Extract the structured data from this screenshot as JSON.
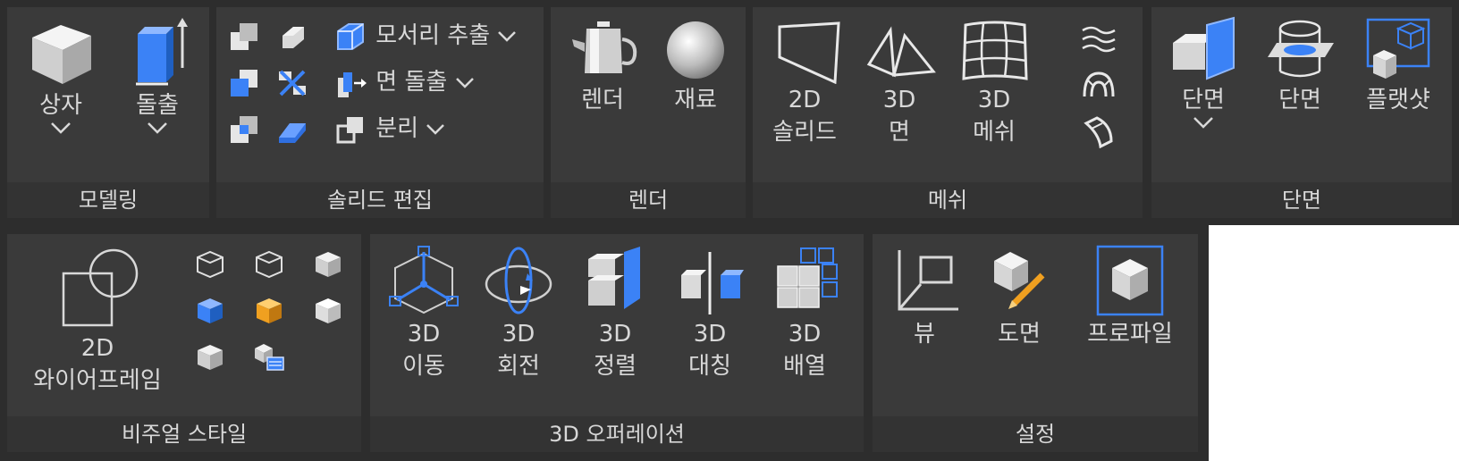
{
  "ribbon": {
    "modeling": {
      "title": "모델링",
      "box_label": "상자",
      "extrude_label": "돌출"
    },
    "solid_edit": {
      "title": "솔리드 편집",
      "edge_extract_label": "모서리 추출",
      "face_extrude_label": "면 돌출",
      "separate_label": "분리"
    },
    "render": {
      "title": "렌더",
      "render_label": "렌더",
      "material_label": "재료"
    },
    "mesh": {
      "title": "메쉬",
      "solid2d_line1": "2D",
      "solid2d_line2": "솔리드",
      "face3d_line1": "3D",
      "face3d_line2": "면",
      "mesh3d_line1": "3D",
      "mesh3d_line2": "메쉬"
    },
    "section": {
      "title": "단면",
      "section_plane_label": "단면",
      "section_label": "단면",
      "flatshot_label": "플랫샷"
    },
    "visual_style": {
      "title": "비주얼 스타일",
      "wire2d_line1": "2D",
      "wire2d_line2": "와이어프레임"
    },
    "ops3d": {
      "title": "3D 오퍼레이션",
      "move_line1": "3D",
      "move_line2": "이동",
      "rotate_line1": "3D",
      "rotate_line2": "회전",
      "align_line1": "3D",
      "align_line2": "정렬",
      "mirror_line1": "3D",
      "mirror_line2": "대칭",
      "array_line1": "3D",
      "array_line2": "배열"
    },
    "settings": {
      "title": "설정",
      "view_label": "뷰",
      "drawing_label": "도면",
      "profile_label": "프로파일"
    }
  },
  "colors": {
    "background": "#2d2d2d",
    "panel": "#3a3a3a",
    "panel_title_bar": "#333333",
    "text": "#d8d8d8",
    "accent_blue": "#3b82f6",
    "accent_orange": "#f0a020"
  }
}
